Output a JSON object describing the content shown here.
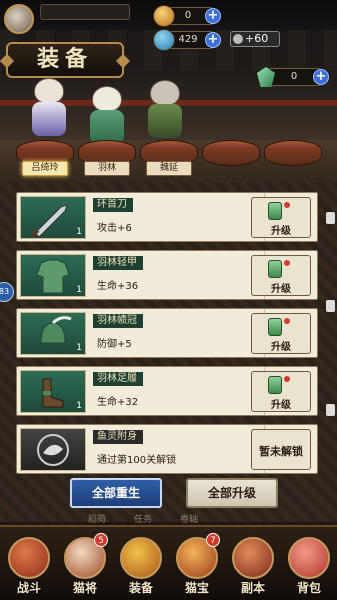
{
  "header": {
    "player_name": "",
    "resource1": {
      "value": "0",
      "icon": "gold-coin-icon"
    },
    "resource2": {
      "value": "429",
      "icon": "fish-icon"
    },
    "bonus": "+60",
    "gem": {
      "value": "0",
      "icon": "jade-gem-icon"
    }
  },
  "page_title": "装备",
  "heroes": [
    {
      "name": "吕绮玲",
      "active": true
    },
    {
      "name": "羽林",
      "active": false
    },
    {
      "name": "魏延",
      "active": false
    },
    {
      "name": "",
      "active": false
    },
    {
      "name": "",
      "active": false
    }
  ],
  "equipment": [
    {
      "name": "环首刀",
      "stat": "攻击+6",
      "level": "1",
      "action": "升级",
      "icon": "sword-icon"
    },
    {
      "name": "羽林轻甲",
      "stat": "生命+36",
      "level": "1",
      "action": "升级",
      "icon": "armor-icon"
    },
    {
      "name": "羽林帻冠",
      "stat": "防御+5",
      "level": "1",
      "action": "升级",
      "icon": "helmet-icon"
    },
    {
      "name": "羽林足履",
      "stat": "生命+32",
      "level": "1",
      "action": "升级",
      "icon": "boots-icon"
    },
    {
      "name": "鱼灵附身",
      "stat": "通过第100关解锁",
      "level": "",
      "action": "暂未解锁",
      "icon": "fish-spirit-icon"
    }
  ],
  "buttons": {
    "reset_all": "全部重生",
    "upgrade_all": "全部升级"
  },
  "subtabs": [
    "稻荷",
    "任务",
    "卷轴"
  ],
  "side_badge": "83",
  "nav": [
    {
      "label": "战斗",
      "badge": "",
      "icon": "battle-icon"
    },
    {
      "label": "猫将",
      "badge": "5",
      "icon": "cat-general-icon"
    },
    {
      "label": "装备",
      "badge": "",
      "icon": "equipment-icon"
    },
    {
      "label": "猫宝",
      "badge": "7",
      "icon": "cat-treasure-icon"
    },
    {
      "label": "副本",
      "badge": "",
      "icon": "dungeon-icon"
    },
    {
      "label": "背包",
      "badge": "",
      "icon": "backpack-icon"
    }
  ]
}
